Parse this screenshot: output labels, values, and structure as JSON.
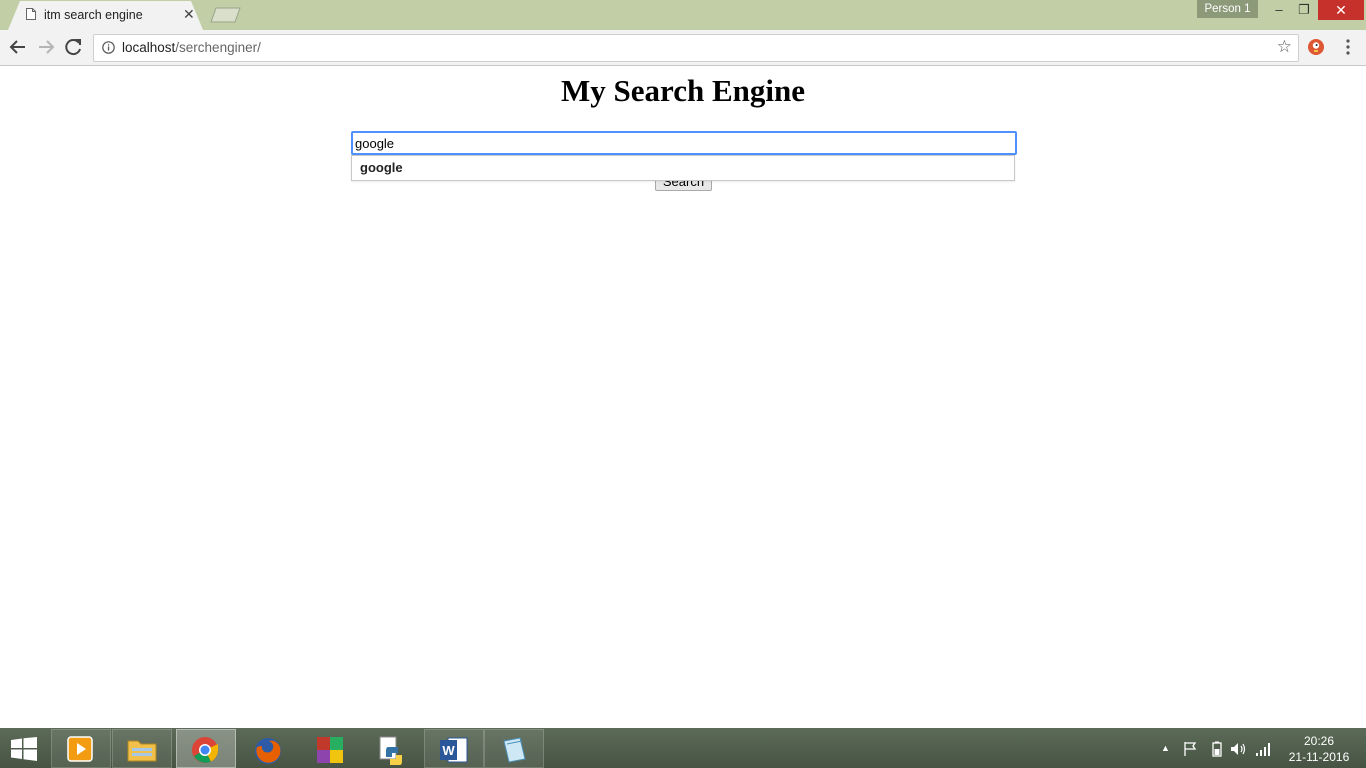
{
  "browser": {
    "tab_title": "itm search engine",
    "tab_close": "✕",
    "profile_label": "Person 1",
    "window_controls": {
      "minimize": "–",
      "restore": "❐",
      "close": "✕"
    },
    "url_host": "localhost",
    "url_path": "/serchenginer/",
    "bookmark_star": "☆"
  },
  "page": {
    "title": "My Search Engine",
    "search_value": "google",
    "autocomplete_suggestion": "google",
    "search_button_label": "Search"
  },
  "taskbar": {
    "apps": [
      "media-player-icon",
      "file-explorer-icon",
      "chrome-icon",
      "firefox-icon",
      "winrar-icon",
      "python-icon",
      "word-icon",
      "notepad-icon"
    ],
    "tray_up_arrow": "▲",
    "time": "20:26",
    "date": "21-11-2016"
  },
  "colors": {
    "titlebar": "#c2cfa6",
    "focus_ring": "#4d90fe",
    "close_button": "#c7312b"
  }
}
